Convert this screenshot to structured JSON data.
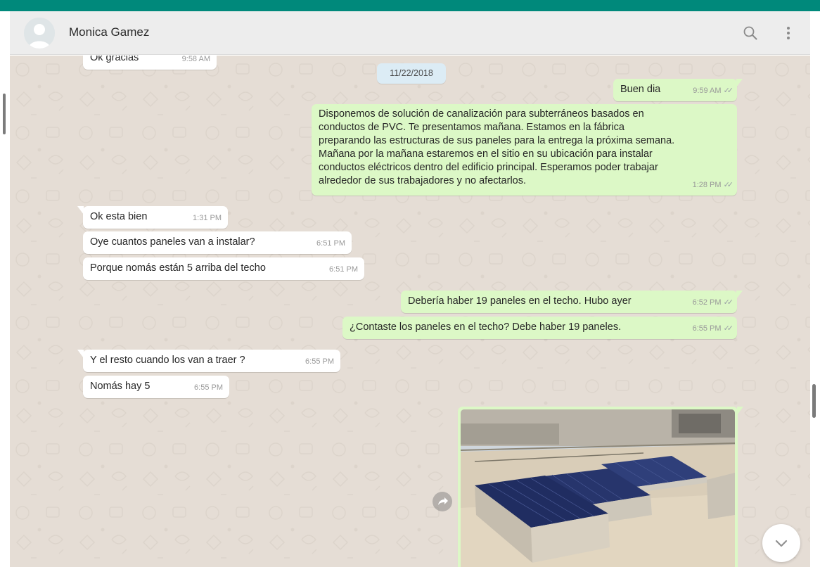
{
  "contact": {
    "name": "Monica Gamez"
  },
  "header": {
    "search_icon": "search-icon",
    "menu_icon": "vertical-dots-icon"
  },
  "date_separator": "11/22/2018",
  "messages": [
    {
      "dir": "in",
      "text": "Ok gracias",
      "time": "9:58 AM"
    },
    {
      "dir": "out",
      "text": "Buen dia",
      "time": "9:59 AM"
    },
    {
      "dir": "out",
      "lines": [
        "Disponemos de solución de canalización para subterráneos basados en",
        "conductos de PVC. Te presentamos mañana. Estamos en la fábrica",
        "preparando las estructuras de sus paneles para la entrega la próxima semana.",
        "Mañana por la mañana estaremos en el sitio en su ubicación para instalar",
        "conductos eléctricos dentro del edificio principal. Esperamos poder trabajar",
        "alrededor de sus trabajadores y no afectarlos."
      ],
      "time": "1:28 PM"
    },
    {
      "dir": "in",
      "text": "Ok esta bien",
      "time": "1:31 PM"
    },
    {
      "dir": "in",
      "text": "Oye cuantos paneles van a instalar?",
      "time": "6:51 PM"
    },
    {
      "dir": "in",
      "text": "Porque nomás están 5 arriba del techo",
      "time": "6:51 PM"
    },
    {
      "dir": "out",
      "text": "Debería haber 19 paneles en el techo. Hubo ayer",
      "time": "6:52 PM"
    },
    {
      "dir": "out",
      "text": "¿Contaste los paneles en el techo? Debe haber 19 paneles.",
      "time": "6:55 PM"
    },
    {
      "dir": "in",
      "text": "Y el resto cuando los van a traer ?",
      "time": "6:55 PM"
    },
    {
      "dir": "in",
      "text": "Nomás hay 5",
      "time": "6:55 PM"
    },
    {
      "dir": "out",
      "type": "image",
      "content": "solar-panels-on-roof-photo"
    }
  ],
  "read_receipt_icon": "double-check-icon",
  "colors": {
    "accent": "#00897b",
    "chat_bg": "#e5ddd5",
    "outgoing": "#dcf8c6",
    "incoming": "#ffffff",
    "date_chip": "#dcecf5"
  }
}
